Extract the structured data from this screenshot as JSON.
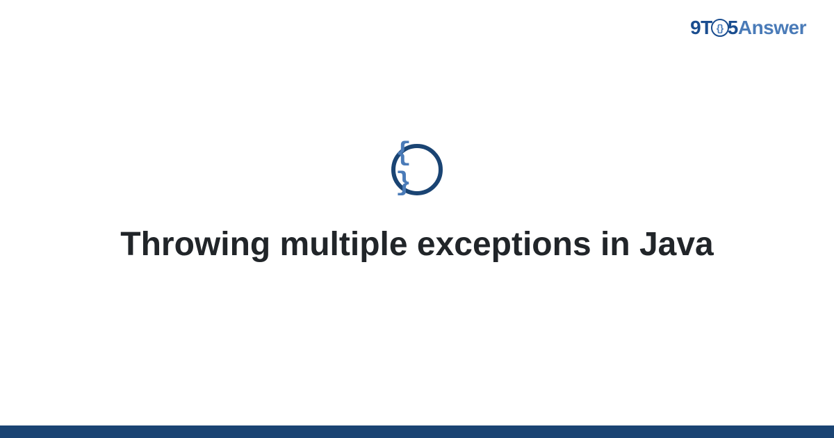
{
  "header": {
    "logo": {
      "part1": "9T",
      "circle_content": "{}",
      "part2": "5",
      "part3": "Answer"
    }
  },
  "main": {
    "icon_braces": "{ }",
    "title": "Throwing multiple exceptions in Java"
  },
  "colors": {
    "dark_blue": "#1a4473",
    "medium_blue": "#1a4d8f",
    "light_blue": "#4a7bb8",
    "text": "#212529"
  }
}
